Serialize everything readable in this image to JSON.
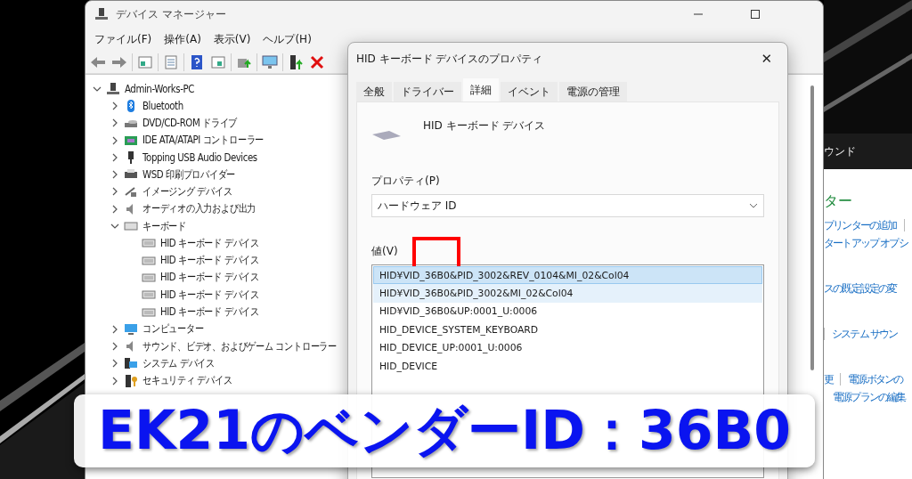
{
  "device_manager": {
    "title": "デバイス マネージャー",
    "menu": [
      "ファイル(F)",
      "操作(A)",
      "表示(V)",
      "ヘルプ(H)"
    ],
    "tree": {
      "label": "Admin-Works-PC",
      "expanded": true,
      "children": [
        {
          "label": "Bluetooth",
          "expanded": false
        },
        {
          "label": "DVD/CD-ROM ドライブ",
          "expanded": false
        },
        {
          "label": "IDE ATA/ATAPI コントローラー",
          "expanded": false
        },
        {
          "label": "Topping USB Audio Devices",
          "expanded": false
        },
        {
          "label": "WSD 印刷プロバイダー",
          "expanded": false
        },
        {
          "label": "イメージング デバイス",
          "expanded": false
        },
        {
          "label": "オーディオの入力および出力",
          "expanded": false
        },
        {
          "label": "キーボード",
          "expanded": true,
          "children": [
            {
              "label": "HID キーボード デバイス"
            },
            {
              "label": "HID キーボード デバイス"
            },
            {
              "label": "HID キーボード デバイス"
            },
            {
              "label": "HID キーボード デバイス"
            },
            {
              "label": "HID キーボード デバイス"
            }
          ]
        },
        {
          "label": "コンピューター",
          "expanded": false
        },
        {
          "label": "サウンド、ビデオ、およびゲーム コントローラー",
          "expanded": false
        },
        {
          "label": "システム デバイス",
          "expanded": false
        },
        {
          "label": "セキュリティ デバイス",
          "expanded": false
        }
      ]
    }
  },
  "properties_dialog": {
    "title": "HID キーボード デバイスのプロパティ",
    "close": "✕",
    "tabs": [
      {
        "label": "全般",
        "selected": false
      },
      {
        "label": "ドライバー",
        "selected": false
      },
      {
        "label": "詳細",
        "selected": true
      },
      {
        "label": "イベント",
        "selected": false
      },
      {
        "label": "電源の管理",
        "selected": false
      }
    ],
    "device_name": "HID キーボード デバイス",
    "property_label": "プロパティ(P)",
    "property_value": "ハードウェア ID",
    "value_label": "値(V)",
    "values": [
      {
        "text": "HID¥VID_36B0&PID_3002&REV_0104&MI_02&Col04",
        "selected": true,
        "hovered": false
      },
      {
        "text": "HID¥VID_36B0&PID_3002&MI_02&Col04",
        "selected": false,
        "hovered": true
      },
      {
        "text": "HID¥VID_36B0&UP:0001_U:0006",
        "selected": false,
        "hovered": false
      },
      {
        "text": "HID_DEVICE_SYSTEM_KEYBOARD",
        "selected": false,
        "hovered": false
      },
      {
        "text": "HID_DEVICE_UP:0001_U:0006",
        "selected": false,
        "hovered": false
      },
      {
        "text": "HID_DEVICE",
        "selected": false,
        "hovered": false
      }
    ]
  },
  "control_panel": {
    "header": "ウンド",
    "heading": "ター",
    "lines": [
      {
        "links": [
          "プリンターの追加"
        ],
        "leading_separator": false,
        "trailing_separator": true,
        "indent": false
      },
      {
        "links": [
          "タートアップ オプシ"
        ],
        "leading_separator": false,
        "indent": false
      },
      {
        "links": [
          "スの既定設定の変"
        ],
        "leading_separator": false,
        "indent": false
      },
      {
        "links": [
          "システム サウン"
        ],
        "leading_separator": true,
        "indent": false
      },
      {
        "links": [
          "更",
          "電源ボタンの"
        ],
        "leading_separator": false,
        "indent": false
      },
      {
        "links": [
          "電源プランの編集"
        ],
        "leading_separator": false,
        "indent": true
      }
    ]
  },
  "banner": {
    "text": "EK21のベンダーID：36B0"
  }
}
